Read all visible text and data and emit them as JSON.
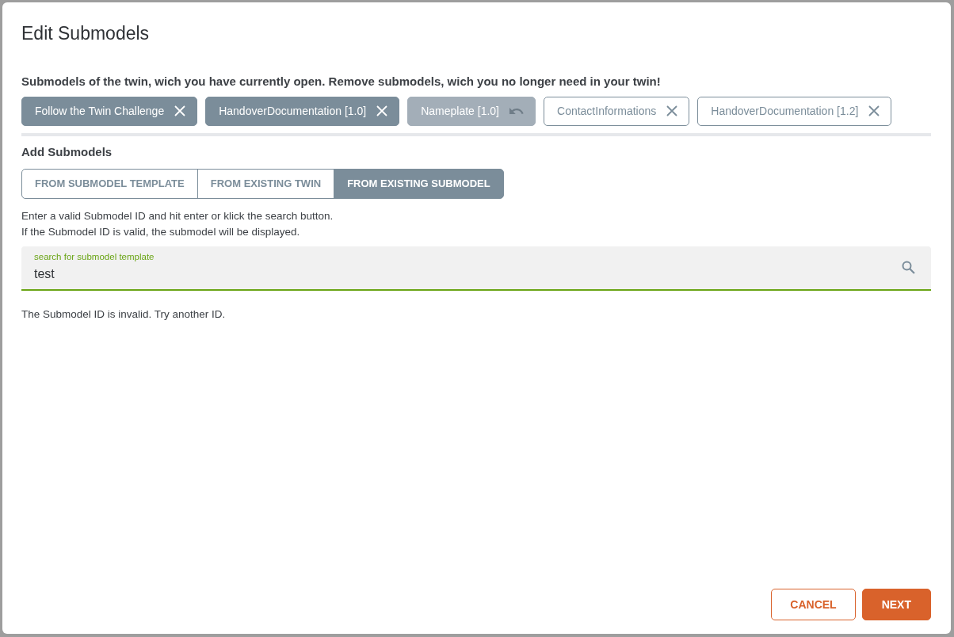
{
  "dialog": {
    "title": "Edit Submodels"
  },
  "current_submodels": {
    "description": "Submodels of the twin, wich you have currently open. Remove submodels, wich you no longer need in your twin!",
    "chips": [
      {
        "label": "Follow the Twin Challenge",
        "selected": true,
        "removed": false
      },
      {
        "label": "HandoverDocumentation [1.0]",
        "selected": true,
        "removed": false
      },
      {
        "label": "Nameplate [1.0]",
        "selected": true,
        "removed": true
      },
      {
        "label": "ContactInformations",
        "selected": false,
        "removed": false
      },
      {
        "label": "HandoverDocumentation [1.2]",
        "selected": false,
        "removed": false
      }
    ]
  },
  "add_submodels": {
    "heading": "Add Submodels",
    "tabs": [
      {
        "label": "FROM SUBMODEL TEMPLATE",
        "selected": false
      },
      {
        "label": "FROM EXISTING TWIN",
        "selected": false
      },
      {
        "label": "FROM EXISTING SUBMODEL",
        "selected": true
      }
    ],
    "help_lines": [
      "Enter a valid Submodel ID and hit enter or klick the search button.",
      "If the Submodel ID is valid, the submodel will be displayed."
    ],
    "search": {
      "label": "search for submodel template",
      "value": "test"
    },
    "message": "The Submodel ID is invalid. Try another ID."
  },
  "buttons": [
    {
      "label": "CANCEL",
      "kind": "secondary"
    },
    {
      "label": "NEXT",
      "kind": "primary"
    }
  ]
}
